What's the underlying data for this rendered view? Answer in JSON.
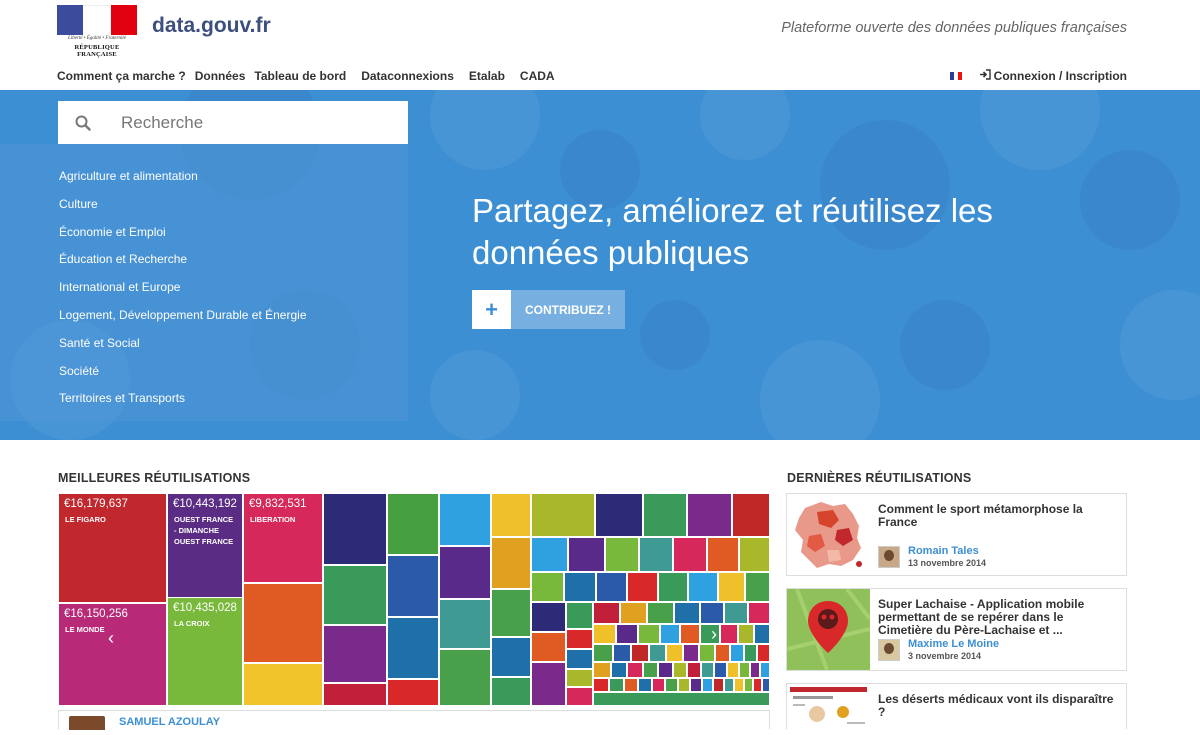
{
  "header": {
    "logo_motto": "Liberté • Égalité • Fraternité",
    "logo_republic": "RÉPUBLIQUE FRANÇAISE",
    "site_name": "data.gouv.fr",
    "tagline": "Plateforme ouverte des données publiques françaises",
    "nav": [
      "Comment ça marche ?",
      "Données",
      "Tableau de bord",
      "Dataconnexions",
      "Etalab",
      "CADA"
    ],
    "login_label": "Connexion / Inscription",
    "language_flag": "fr-flag-icon"
  },
  "hero": {
    "search_placeholder": "Recherche",
    "topics": [
      "Agriculture et alimentation",
      "Culture",
      "Économie et Emploi",
      "Éducation et Recherche",
      "International et Europe",
      "Logement, Développement Durable et Énergie",
      "Santé et Social",
      "Société",
      "Territoires et Transports"
    ],
    "title_line1": "Partagez, améliorez et réutilisez les",
    "title_line2": "données publiques",
    "contribute_plus": "+",
    "contribute_label": "CONTRIBUEZ !"
  },
  "best_reuses": {
    "title": "MEILLEURES RÉUTILISATIONS",
    "tiles": [
      {
        "value": "€16,179,637",
        "label": "LE FIGARO"
      },
      {
        "value": "€10,443,192",
        "label": "OUEST FRANCE\n- DIMANCHE\nOUEST FRANCE"
      },
      {
        "value": "€9,832,531",
        "label": "LIBERATION"
      },
      {
        "value": "€16,150,256",
        "label": "LE MONDE"
      },
      {
        "value": "€10,435,028",
        "label": "LA CROIX"
      }
    ],
    "author": "SAMUEL AZOULAY"
  },
  "latest_reuses": {
    "title": "DERNIÈRES RÉUTILISATIONS",
    "items": [
      {
        "title": "Comment le sport métamorphose la France",
        "author": "Romain Tales",
        "date": "13 novembre 2014"
      },
      {
        "title": "Super Lachaise - Application mobile permettant de se repérer dans le Cimetière du Père-Lachaise et ...",
        "author": "Maxime Le Moine",
        "date": "3 novembre 2014"
      },
      {
        "title": "Les déserts médicaux vont ils disparaître ?"
      }
    ]
  },
  "colors": {
    "hero_blue": "#3d8fd3",
    "link_blue": "#3d8fd3",
    "brand_navy": "#3e4f7e"
  }
}
